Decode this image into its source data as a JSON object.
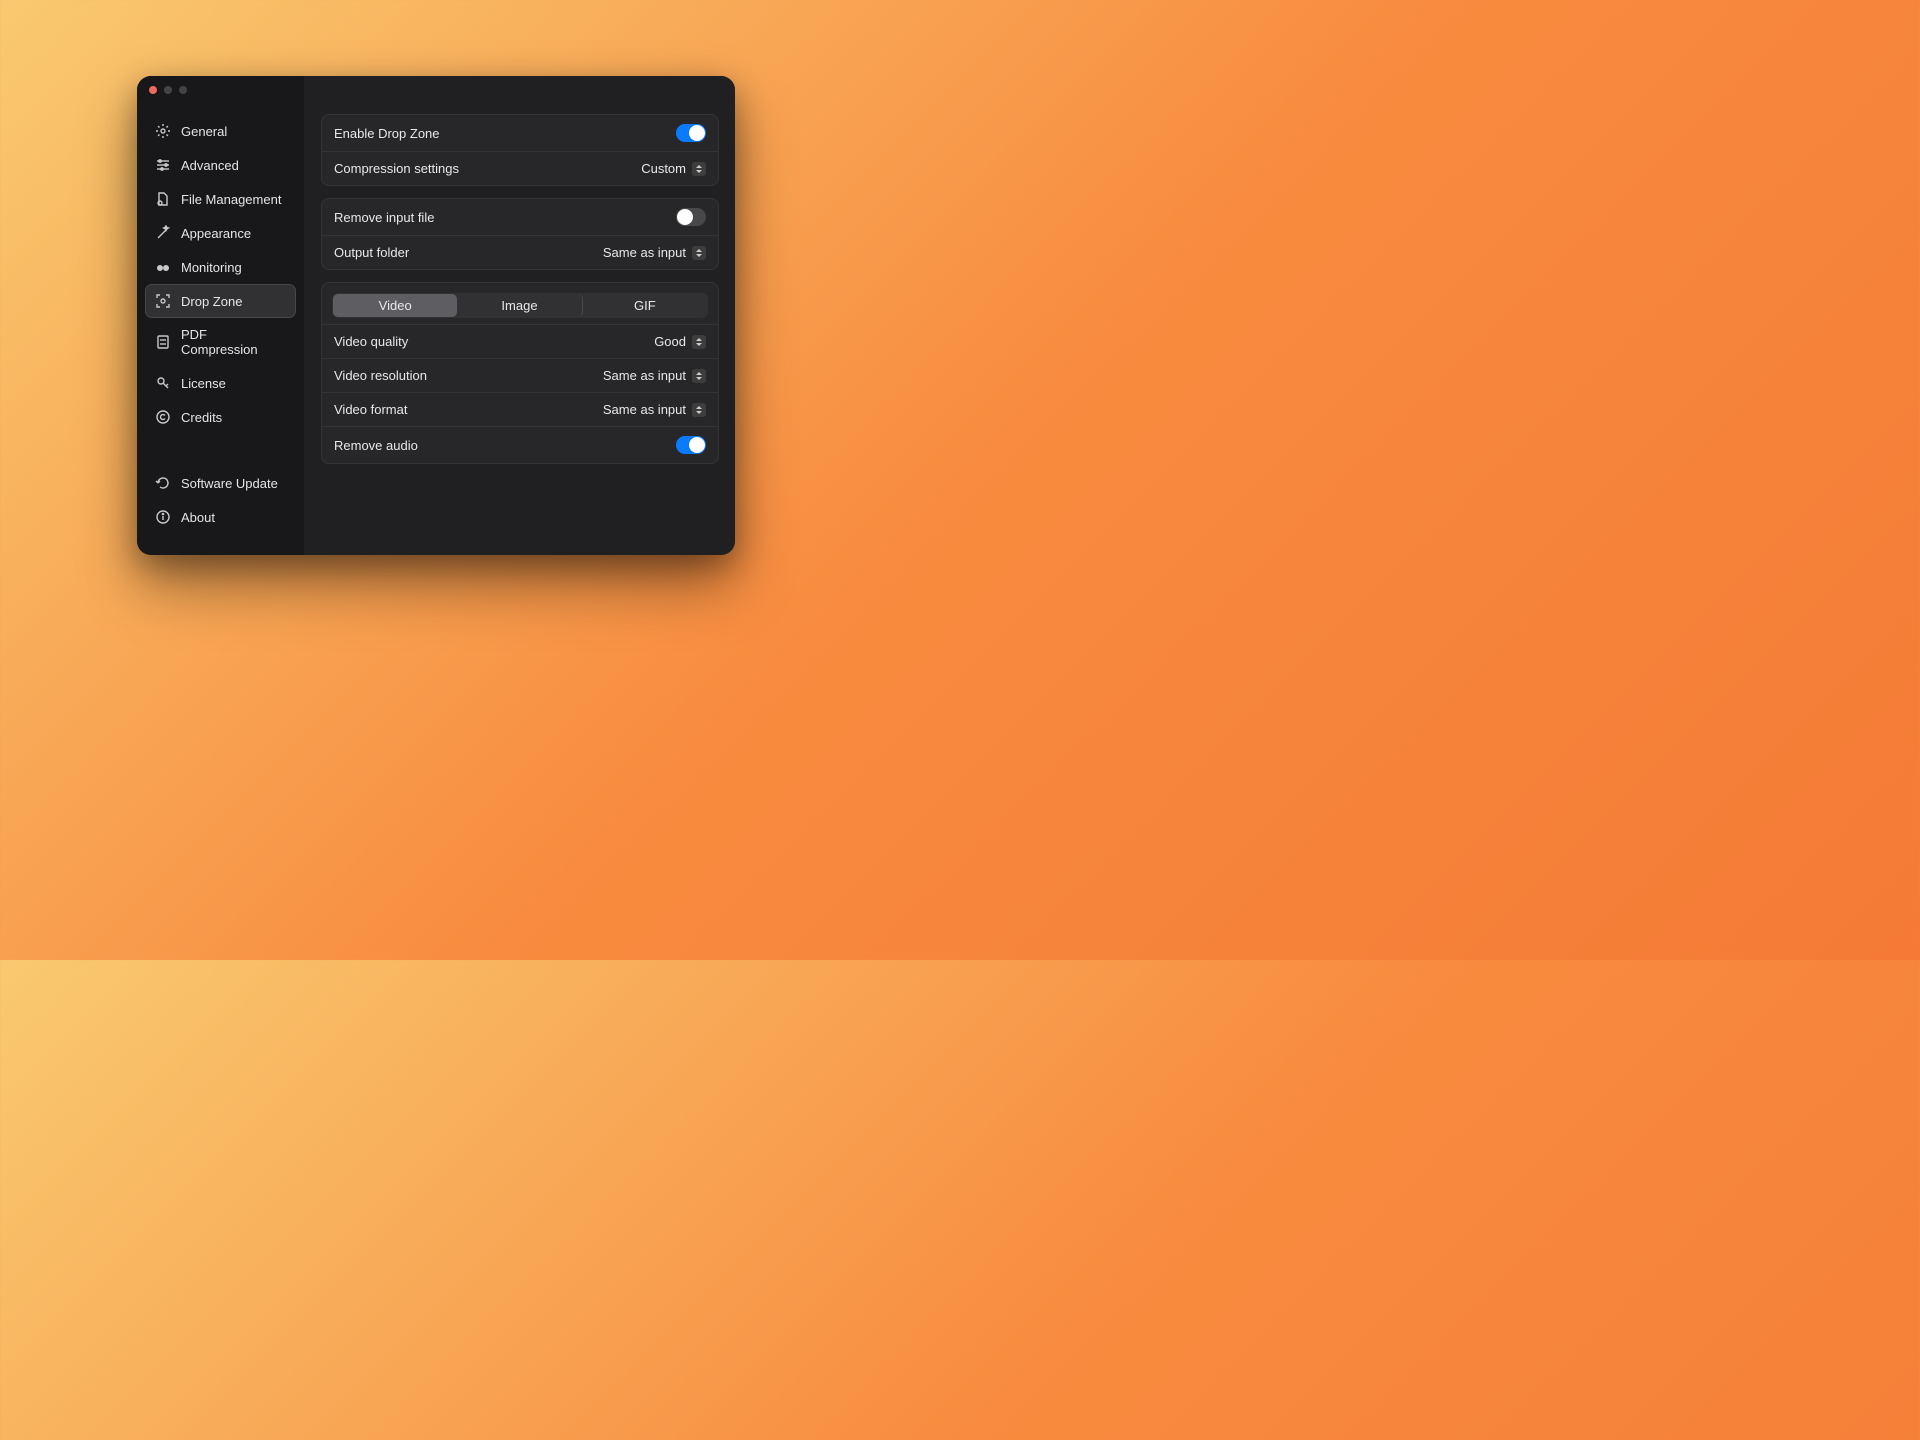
{
  "sidebar": {
    "items": [
      {
        "label": "General",
        "icon": "gear-icon"
      },
      {
        "label": "Advanced",
        "icon": "sliders-icon"
      },
      {
        "label": "File Management",
        "icon": "file-gear-icon"
      },
      {
        "label": "Appearance",
        "icon": "wand-icon"
      },
      {
        "label": "Monitoring",
        "icon": "binoculars-icon"
      },
      {
        "label": "Drop Zone",
        "icon": "drop-target-icon",
        "selected": true
      },
      {
        "label": "PDF Compression",
        "icon": "pdf-icon"
      },
      {
        "label": "License",
        "icon": "key-icon"
      },
      {
        "label": "Credits",
        "icon": "copyright-icon"
      }
    ],
    "footer_items": [
      {
        "label": "Software Update",
        "icon": "refresh-icon"
      },
      {
        "label": "About",
        "icon": "info-icon"
      }
    ]
  },
  "panels": {
    "group1": {
      "enable_drop_zone": {
        "label": "Enable Drop Zone",
        "value": true
      },
      "compression_settings": {
        "label": "Compression settings",
        "value": "Custom"
      }
    },
    "group2": {
      "remove_input_file": {
        "label": "Remove input file",
        "value": false
      },
      "output_folder": {
        "label": "Output folder",
        "value": "Same as input"
      }
    },
    "media": {
      "tabs": [
        "Video",
        "Image",
        "GIF"
      ],
      "active_tab": "Video",
      "video_quality": {
        "label": "Video quality",
        "value": "Good"
      },
      "video_resolution": {
        "label": "Video resolution",
        "value": "Same as input"
      },
      "video_format": {
        "label": "Video format",
        "value": "Same as input"
      },
      "remove_audio": {
        "label": "Remove audio",
        "value": true
      }
    }
  }
}
